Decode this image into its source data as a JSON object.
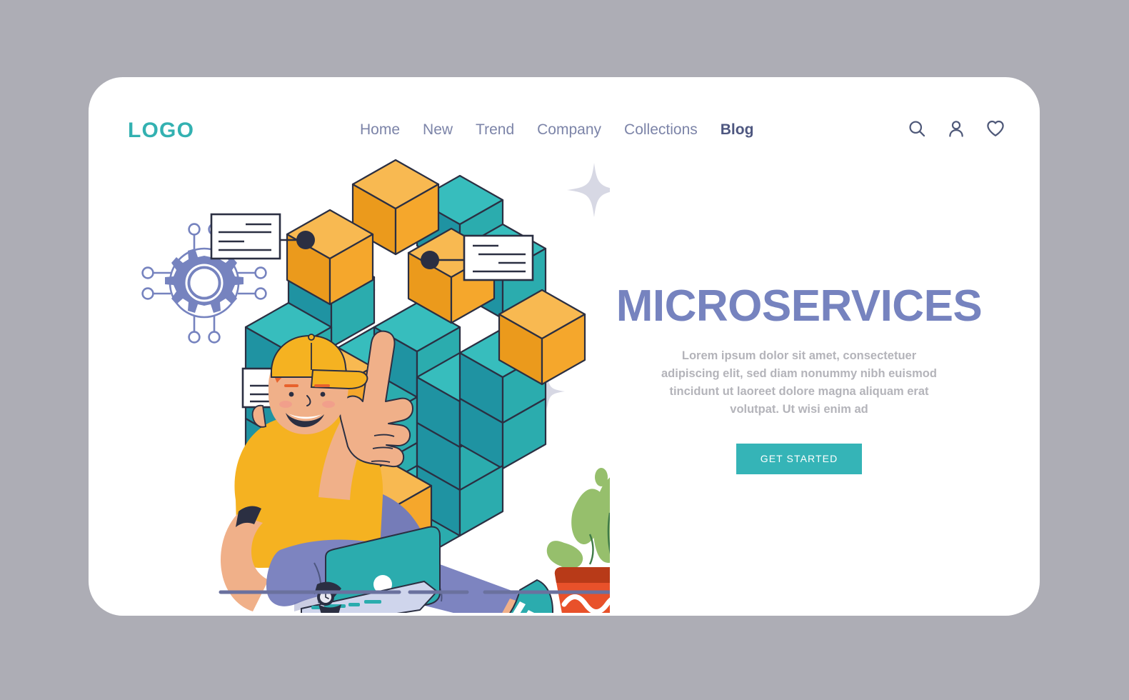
{
  "theme": {
    "page_background": "#adadb5",
    "card_background": "#ffffff",
    "brand_teal": "#33b1b1",
    "accent_teal": "#35b4b7",
    "cube_teal": "#2bacae",
    "cube_orange": "#f5a72c",
    "heading_periwinkle": "#7683bf",
    "nav_text": "#7c84a8",
    "nav_active": "#4e5780",
    "body_text": "#b4b4ba",
    "outline_dark": "#2b2f42",
    "denim_blue": "#7d84c0",
    "sparkle_gray": "#d4d5e2",
    "plant_pot_orange": "#e8512a",
    "plant_green": "#96bf6c"
  },
  "header": {
    "logo": "LOGO",
    "nav": [
      {
        "label": "Home",
        "active": false
      },
      {
        "label": "New",
        "active": false
      },
      {
        "label": "Trend",
        "active": false
      },
      {
        "label": "Company",
        "active": false
      },
      {
        "label": "Collections",
        "active": false
      },
      {
        "label": "Blog",
        "active": true
      }
    ],
    "actions": [
      {
        "icon": "search-icon",
        "label": "Search"
      },
      {
        "icon": "user-icon",
        "label": "Account"
      },
      {
        "icon": "heart-icon",
        "label": "Favorites"
      }
    ]
  },
  "hero": {
    "title": "MICROSERVICES",
    "paragraph": "Lorem ipsum dolor sit amet, consectetuer adipiscing elit, sed diam nonummy nibh euismod tincidunt ut laoreet dolore magna aliquam erat volutpat. Ut wisi enim ad",
    "cta_label": "GET STARTED"
  },
  "illustration": {
    "alt": "Man sitting with a laptop pointing at an isometric cube made of teal and orange blocks",
    "elements": [
      {
        "name": "gear-network-icon",
        "description": "Gear inside circle with network nodes"
      },
      {
        "name": "isometric-cube-cluster",
        "description": "Cluster of teal and orange isometric cubes"
      },
      {
        "name": "callout-card-left",
        "description": "Tooltip card with 4 text lines"
      },
      {
        "name": "callout-card-right",
        "description": "Tooltip card with 4 text lines"
      },
      {
        "name": "callout-card-lower",
        "description": "Tooltip card with 3 text lines"
      },
      {
        "name": "seated-person",
        "description": "Man with orange cap, yellow shirt, denim jeans"
      },
      {
        "name": "laptop",
        "description": "Teal laptop on the lap"
      },
      {
        "name": "potted-plant",
        "description": "Green plant in an orange pot with white wave band"
      },
      {
        "name": "sparkle-large",
        "description": "Four pointed sparkle"
      },
      {
        "name": "ground-lines",
        "description": "Three horizontal floor line segments"
      }
    ]
  }
}
